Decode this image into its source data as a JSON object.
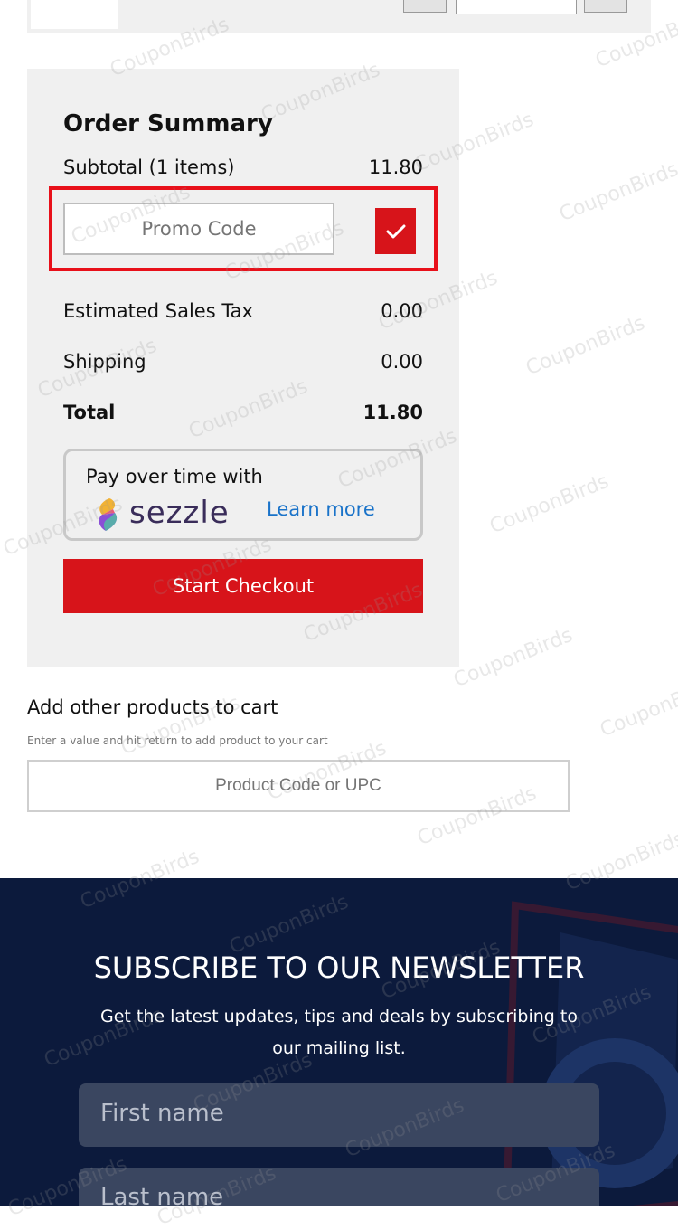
{
  "order_summary": {
    "title": "Order Summary",
    "subtotal_label": "Subtotal (1 items)",
    "subtotal_value": "11.80",
    "promo_placeholder": "Promo Code",
    "tax_label": "Estimated Sales Tax",
    "tax_value": "0.00",
    "shipping_label": "Shipping",
    "shipping_value": "0.00",
    "total_label": "Total",
    "total_value": "11.80",
    "sezzle": {
      "text": "Pay over time with",
      "brand": "sezzle",
      "link": "Learn more"
    },
    "checkout_label": "Start Checkout"
  },
  "add_products": {
    "title": "Add other products to cart",
    "hint": "Enter a value and hit return to add product to your cart",
    "placeholder": "Product Code or UPC"
  },
  "newsletter": {
    "title": "SUBSCRIBE TO OUR NEWSLETTER",
    "description": "Get the latest updates, tips and deals by subscribing to our mailing list.",
    "first_name_placeholder": "First name",
    "last_name_placeholder": "Last name"
  },
  "watermark": "CouponBirds",
  "colors": {
    "accent": "#d7141a",
    "highlight": "#e8101a",
    "link": "#1a73c9",
    "footer_bg": "#0c1a3c"
  }
}
